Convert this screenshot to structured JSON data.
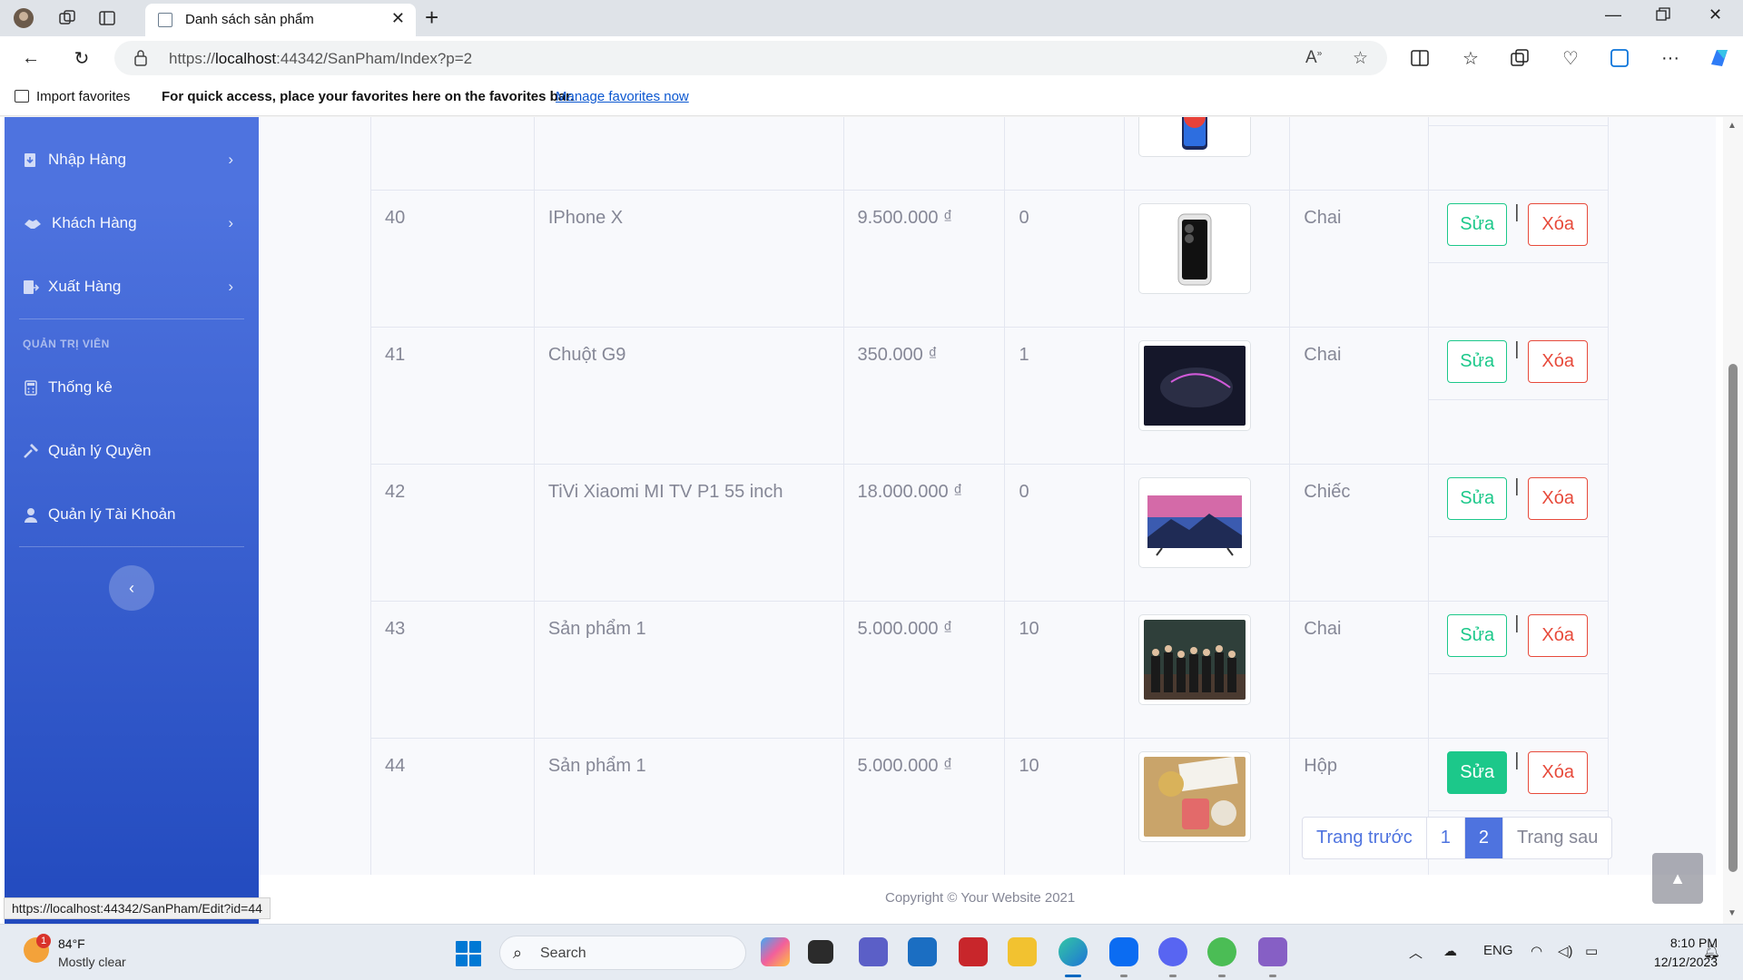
{
  "browser": {
    "tab_title": "Danh sách sản phẩm",
    "url_prefix": "https://",
    "url_host": "localhost",
    "url_rest": ":44342/SanPham/Index?p=2",
    "favorites_import": "Import favorites",
    "favorites_hint": "For quick access, place your favorites here on the favorites bar.",
    "favorites_manage": "Manage favorites now",
    "status_url": "https://localhost:44342/SanPham/Edit?id=44"
  },
  "sidebar": {
    "items_top": [
      {
        "label": "Nhập Hàng",
        "icon": "import-icon"
      },
      {
        "label": "Khách Hàng",
        "icon": "handshake-icon"
      },
      {
        "label": "Xuất Hàng",
        "icon": "export-icon"
      }
    ],
    "admin_heading": "QUẢN TRỊ VIÊN",
    "items_admin": [
      {
        "label": "Thống kê",
        "icon": "calculator-icon"
      },
      {
        "label": "Quản lý Quyền",
        "icon": "hammer-icon"
      },
      {
        "label": "Quản lý Tài Khoản",
        "icon": "user-icon"
      }
    ]
  },
  "table": {
    "rows": [
      {
        "id": "",
        "name": "",
        "price": "",
        "qty": "",
        "unit": "",
        "thumb": "phone-blue-image"
      },
      {
        "id": "40",
        "name": "IPhone X",
        "price": "9.500.000 ₫",
        "qty": "0",
        "unit": "Chai",
        "thumb": "iphone-image"
      },
      {
        "id": "41",
        "name": "Chuột G9",
        "price": "350.000 ₫",
        "qty": "1",
        "unit": "Chai",
        "thumb": "mouse-image"
      },
      {
        "id": "42",
        "name": "TiVi Xiaomi MI TV P1 55 inch",
        "price": "18.000.000 ₫",
        "qty": "0",
        "unit": "Chiếc",
        "thumb": "tv-image"
      },
      {
        "id": "43",
        "name": "Sản phẩm 1",
        "price": "5.000.000 ₫",
        "qty": "10",
        "unit": "Chai",
        "thumb": "group-photo-image"
      },
      {
        "id": "44",
        "name": "Sản phẩm 1",
        "price": "5.000.000 ₫",
        "qty": "10",
        "unit": "Hộp",
        "thumb": "gift-box-image"
      }
    ],
    "edit_label": "Sửa",
    "delete_label": "Xóa",
    "separator": "|"
  },
  "pagination": {
    "prev": "Trang trước",
    "pages": [
      "1",
      "2"
    ],
    "current": "2",
    "next": "Trang sau"
  },
  "footer": {
    "copyright": "Copyright © Your Website 2021"
  },
  "taskbar": {
    "temperature": "84°F",
    "weather": "Mostly clear",
    "weather_badge": "1",
    "search_placeholder": "Search",
    "language": "ENG",
    "time": "8:10 PM",
    "date": "12/12/2023"
  },
  "colors": {
    "sidebar_top": "#4e73df",
    "sidebar_bottom": "#224abe",
    "success": "#1cc88a",
    "danger": "#e74a3b",
    "primary": "#4e73df"
  }
}
